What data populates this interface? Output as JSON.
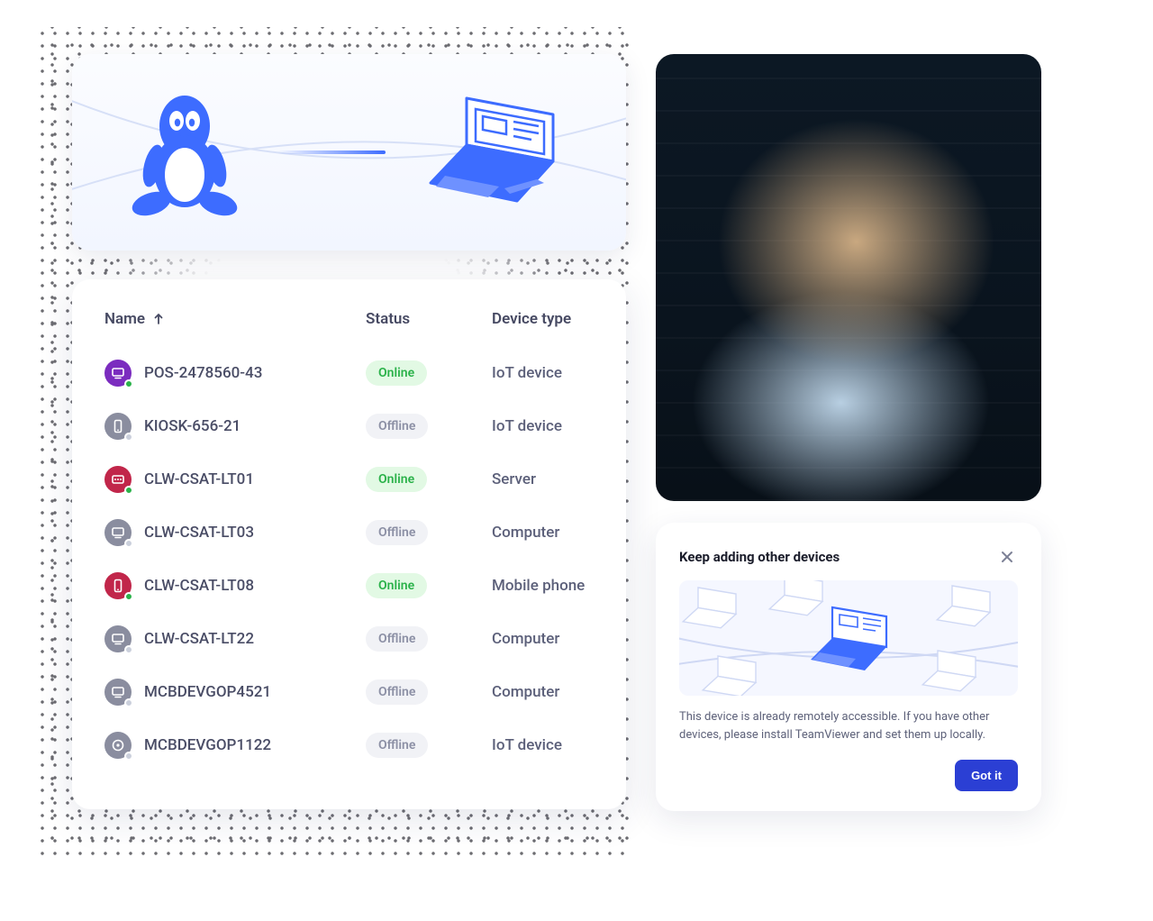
{
  "devices": {
    "columns": {
      "name": "Name",
      "status": "Status",
      "type": "Device type"
    },
    "status_labels": {
      "online": "Online",
      "offline": "Offline"
    },
    "rows": [
      {
        "name": "POS-2478560-43",
        "status": "online",
        "type": "IoT device",
        "icon": "monitor",
        "tint": "purple"
      },
      {
        "name": "KIOSK-656-21",
        "status": "offline",
        "type": "IoT device",
        "icon": "phone",
        "tint": "grey"
      },
      {
        "name": "CLW-CSAT-LT01",
        "status": "online",
        "type": "Server",
        "icon": "server",
        "tint": "red"
      },
      {
        "name": "CLW-CSAT-LT03",
        "status": "offline",
        "type": "Computer",
        "icon": "monitor",
        "tint": "grey"
      },
      {
        "name": "CLW-CSAT-LT08",
        "status": "online",
        "type": "Mobile phone",
        "icon": "phone",
        "tint": "red"
      },
      {
        "name": "CLW-CSAT-LT22",
        "status": "offline",
        "type": "Computer",
        "icon": "monitor",
        "tint": "grey"
      },
      {
        "name": "MCBDEVGOP4521",
        "status": "offline",
        "type": "Computer",
        "icon": "monitor",
        "tint": "grey"
      },
      {
        "name": "MCBDEVGOP1122",
        "status": "offline",
        "type": "IoT device",
        "icon": "disc",
        "tint": "grey"
      }
    ]
  },
  "promo": {
    "title": "Keep adding other devices",
    "body": "This device is already remotely accessible. If you have other devices, please install TeamViewer and set them up locally.",
    "button": "Got it"
  }
}
